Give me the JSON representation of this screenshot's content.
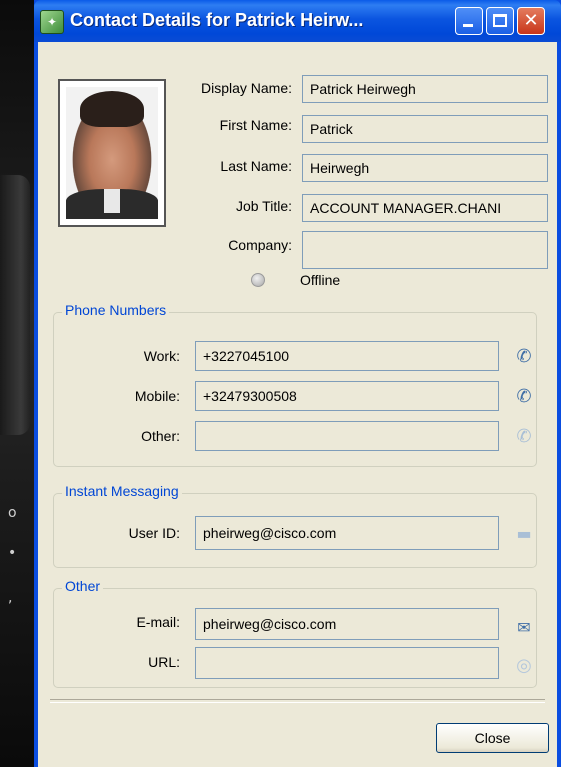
{
  "window": {
    "title": "Contact Details for Patrick Heirw...",
    "accent_color": "#0a4de0"
  },
  "contact": {
    "display_name_label": "Display Name:",
    "display_name_value": "Patrick Heirwegh",
    "first_name_label": "First Name:",
    "first_name_value": "Patrick",
    "last_name_label": "Last Name:",
    "last_name_value": "Heirwegh",
    "job_title_label": "Job Title:",
    "job_title_value": "ACCOUNT MANAGER.CHANI",
    "company_label": "Company:",
    "company_value": "",
    "status_text": "Offline"
  },
  "phone": {
    "group_title": "Phone Numbers",
    "work_label": "Work:",
    "work_value": "+3227045100",
    "mobile_label": "Mobile:",
    "mobile_value": "+32479300508",
    "other_label": "Other:",
    "other_value": "",
    "icon": "phone-icon"
  },
  "im": {
    "group_title": "Instant Messaging",
    "userid_label": "User ID:",
    "userid_value": "pheirweg@cisco.com",
    "icon": "chat-bubble-icon"
  },
  "other": {
    "group_title": "Other",
    "email_label": "E-mail:",
    "email_value": "pheirweg@cisco.com",
    "url_label": "URL:",
    "url_value": "",
    "email_icon": "envelope-icon",
    "url_icon": "globe-icon"
  },
  "buttons": {
    "close_label": "Close"
  }
}
